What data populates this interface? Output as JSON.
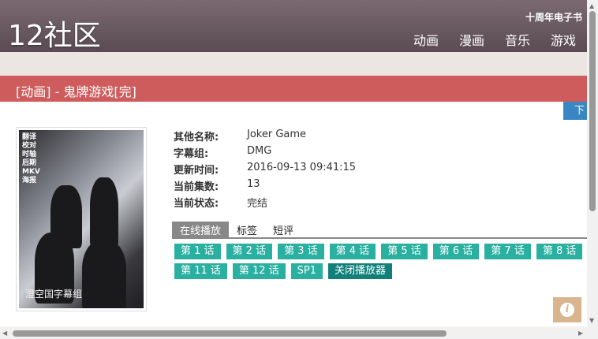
{
  "header": {
    "logo": "12社区",
    "ebook_link": "十周年电子书",
    "nav": [
      "动画",
      "漫画",
      "音乐",
      "游戏"
    ]
  },
  "title_bar": {
    "title": "[动画] - 鬼牌游戏[完]"
  },
  "download_button": "下",
  "poster": {
    "caption": "澄空国字幕组",
    "side_labels": [
      "翻译",
      "校对",
      "时轴",
      "后期",
      "MKV",
      "海报"
    ]
  },
  "info": {
    "rows": [
      {
        "key": "其他名称:",
        "value": "Joker Game"
      },
      {
        "key": "字幕组:",
        "value": "DMG"
      },
      {
        "key": "更新时间:",
        "value": "2016-09-13 09:41:15"
      },
      {
        "key": "当前集数:",
        "value": "13"
      },
      {
        "key": "当前状态:",
        "value": "完结"
      }
    ]
  },
  "tabs": [
    "在线播放",
    "标签",
    "短评"
  ],
  "episodes": {
    "row1": [
      "第 1 话",
      "第 2 话",
      "第 3 话",
      "第 4 话",
      "第 5 话",
      "第 6 话",
      "第 7 话",
      "第 8 话"
    ],
    "row2": [
      "第 11 话",
      "第 12 话",
      "SP1"
    ],
    "close_player": "关闭播放器"
  },
  "colors": {
    "header": "#6b5b62",
    "title_bar": "#cf5c5c",
    "episode_button": "#2ab0a0",
    "close_button": "#11807a",
    "download_button": "#3a86c2"
  },
  "icons": {
    "info": "info-icon"
  }
}
